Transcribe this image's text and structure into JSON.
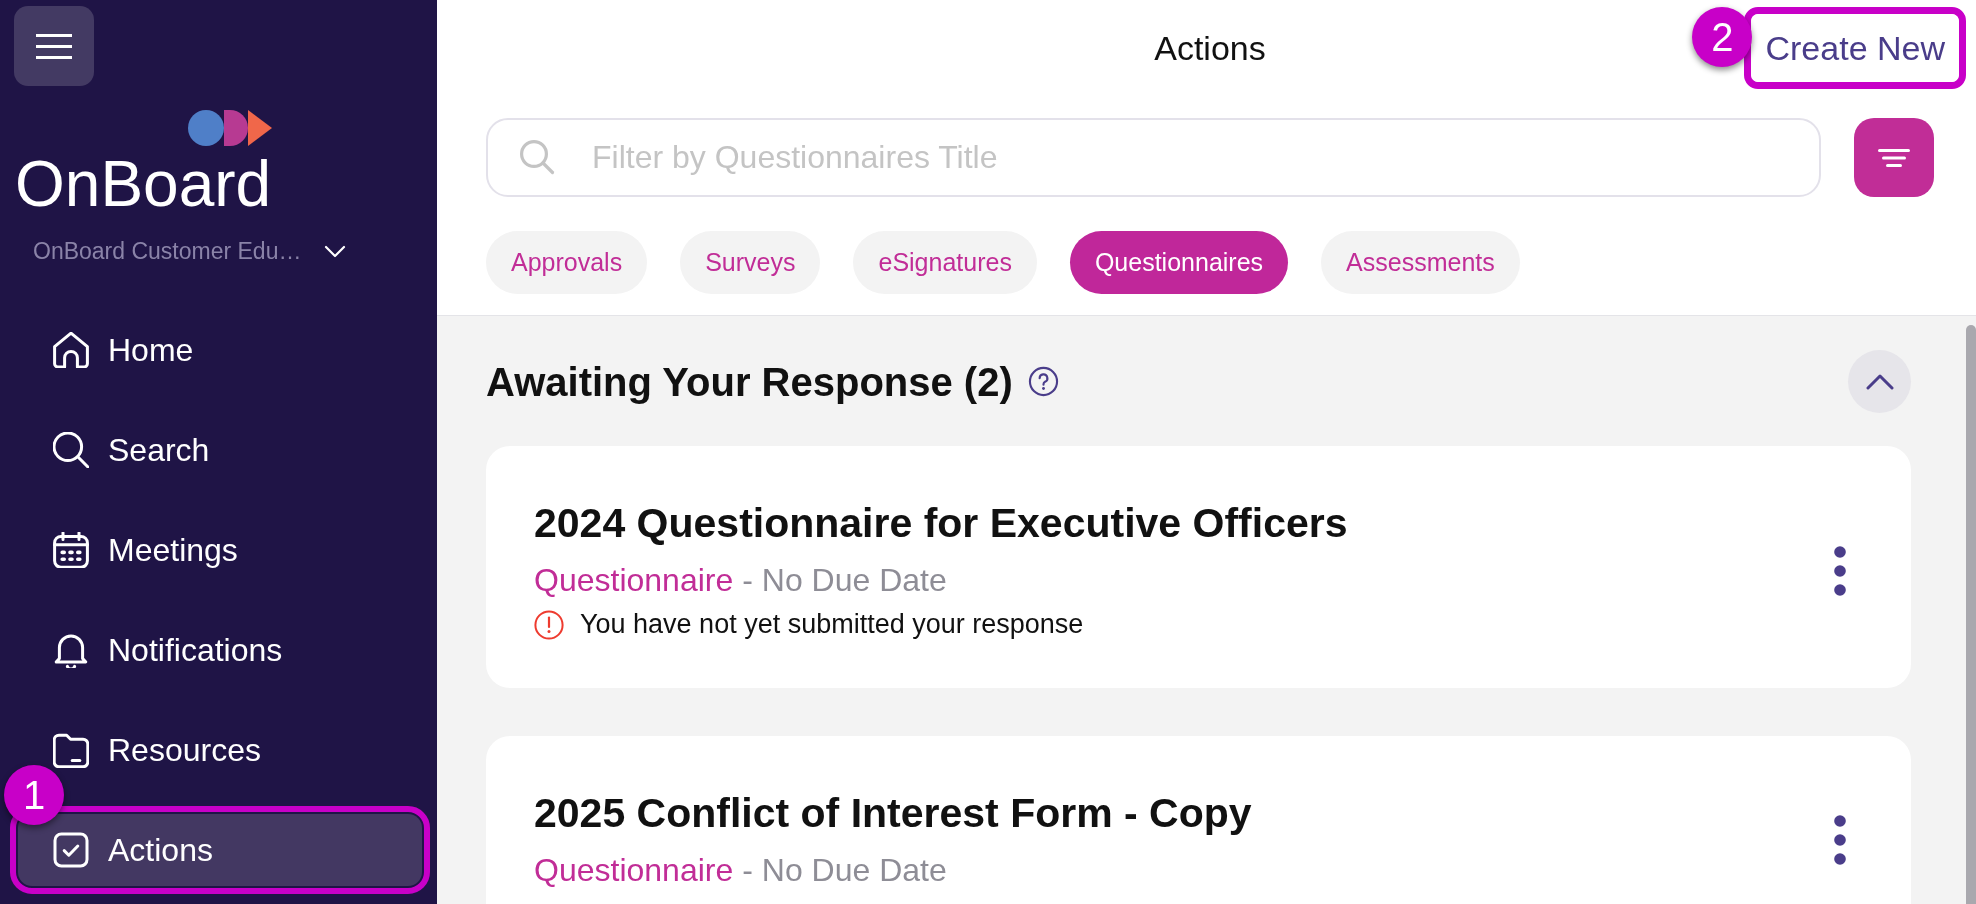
{
  "sidebar": {
    "brand": "OnBoard",
    "organization": "OnBoard Customer Edu…",
    "nav_items": [
      {
        "label": "Home",
        "kind": "home",
        "selected": false
      },
      {
        "label": "Search",
        "kind": "search",
        "selected": false
      },
      {
        "label": "Meetings",
        "kind": "meetings",
        "selected": false
      },
      {
        "label": "Notifications",
        "kind": "notifications",
        "selected": false
      },
      {
        "label": "Resources",
        "kind": "resources",
        "selected": false
      },
      {
        "label": "Actions",
        "kind": "actions",
        "selected": true,
        "callout": "1"
      }
    ]
  },
  "header": {
    "title": "Actions",
    "create_button": {
      "label": "Create New",
      "callout": "2"
    }
  },
  "search": {
    "placeholder": "Filter by Questionnaires Title"
  },
  "tabs": [
    {
      "label": "Approvals",
      "selected": false
    },
    {
      "label": "Surveys",
      "selected": false
    },
    {
      "label": "eSignatures",
      "selected": false
    },
    {
      "label": "Questionnaires",
      "selected": true
    },
    {
      "label": "Assessments",
      "selected": false
    }
  ],
  "section": {
    "title": "Awaiting Your Response (2)",
    "expanded": true,
    "cards": [
      {
        "title": "2024 Questionnaire for Executive Officers",
        "type": "Questionnaire",
        "due": "- No Due Date",
        "warning": "You have not yet submitted your response"
      },
      {
        "title": "2025 Conflict of Interest Form - Copy",
        "type": "Questionnaire",
        "due": "- No Due Date"
      }
    ]
  }
}
